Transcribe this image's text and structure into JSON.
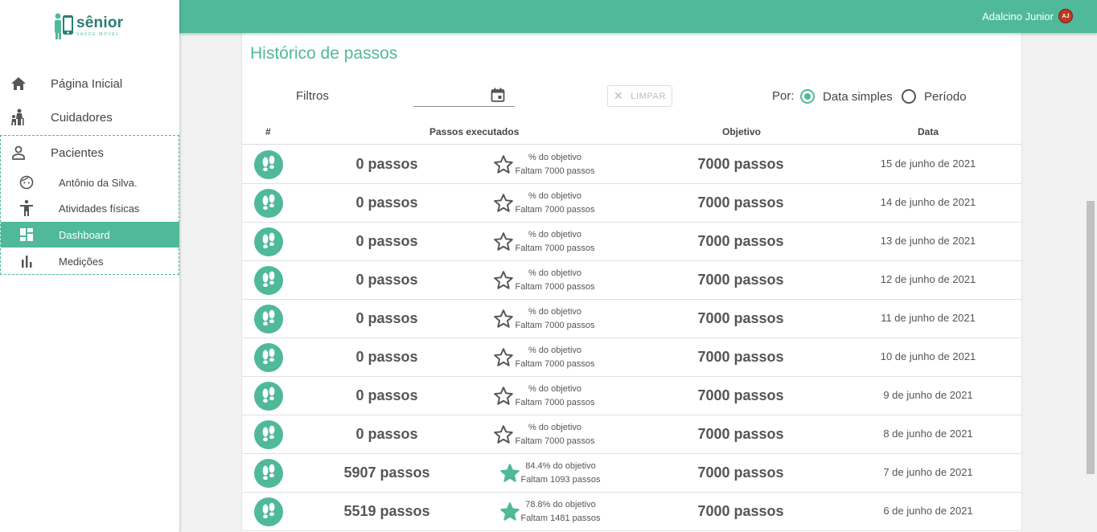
{
  "brand": {
    "name": "sênior",
    "tagline": "SAÚDE MÓVEL"
  },
  "sidebar": {
    "items": [
      {
        "label": "Página Inicial",
        "icon": "home-icon"
      },
      {
        "label": "Cuidadores",
        "icon": "caregiver-icon"
      },
      {
        "label": "Pacientes",
        "icon": "person-icon"
      }
    ],
    "subitems": [
      {
        "label": "Antônio da Silva.",
        "icon": "face-icon"
      },
      {
        "label": "Atividades físicas",
        "icon": "accessibility-icon"
      },
      {
        "label": "Dashboard",
        "icon": "dashboard-icon",
        "active": true
      },
      {
        "label": "Medições",
        "icon": "bar-chart-icon"
      }
    ]
  },
  "header": {
    "user_name": "Adalcino Junior",
    "avatar_initials": "AJ"
  },
  "colors": {
    "accent": "#4fb99a",
    "avatar": "#c2381f"
  },
  "page": {
    "title": "Histórico de passos",
    "filters_label": "Filtros",
    "date_value": "",
    "clear_label": "LIMPAR",
    "por_label": "Por:",
    "radio_simple": "Data simples",
    "radio_period": "Período",
    "selected_mode": "Data simples"
  },
  "table": {
    "headers": {
      "index": "#",
      "steps": "Passos executados",
      "goal": "Objetivo",
      "date": "Data"
    },
    "rows": [
      {
        "steps": "0 passos",
        "pct": "% do objetivo",
        "remaining": "Faltam 7000 passos",
        "goal": "7000 passos",
        "date": "15 de junho de 2021",
        "star_filled": false
      },
      {
        "steps": "0 passos",
        "pct": "% do objetivo",
        "remaining": "Faltam 7000 passos",
        "goal": "7000 passos",
        "date": "14 de junho de 2021",
        "star_filled": false
      },
      {
        "steps": "0 passos",
        "pct": "% do objetivo",
        "remaining": "Faltam 7000 passos",
        "goal": "7000 passos",
        "date": "13 de junho de 2021",
        "star_filled": false
      },
      {
        "steps": "0 passos",
        "pct": "% do objetivo",
        "remaining": "Faltam 7000 passos",
        "goal": "7000 passos",
        "date": "12 de junho de 2021",
        "star_filled": false
      },
      {
        "steps": "0 passos",
        "pct": "% do objetivo",
        "remaining": "Faltam 7000 passos",
        "goal": "7000 passos",
        "date": "11 de junho de 2021",
        "star_filled": false
      },
      {
        "steps": "0 passos",
        "pct": "% do objetivo",
        "remaining": "Faltam 7000 passos",
        "goal": "7000 passos",
        "date": "10 de junho de 2021",
        "star_filled": false
      },
      {
        "steps": "0 passos",
        "pct": "% do objetivo",
        "remaining": "Faltam 7000 passos",
        "goal": "7000 passos",
        "date": "9 de junho de 2021",
        "star_filled": false
      },
      {
        "steps": "0 passos",
        "pct": "% do objetivo",
        "remaining": "Faltam 7000 passos",
        "goal": "7000 passos",
        "date": "8 de junho de 2021",
        "star_filled": false
      },
      {
        "steps": "5907 passos",
        "pct": "84.4% do objetivo",
        "remaining": "Faltam 1093 passos",
        "goal": "7000 passos",
        "date": "7 de junho de 2021",
        "star_filled": true
      },
      {
        "steps": "5519 passos",
        "pct": "78.8% do objetivo",
        "remaining": "Faltam 1481 passos",
        "goal": "7000 passos",
        "date": "6 de junho de 2021",
        "star_filled": true
      }
    ]
  }
}
